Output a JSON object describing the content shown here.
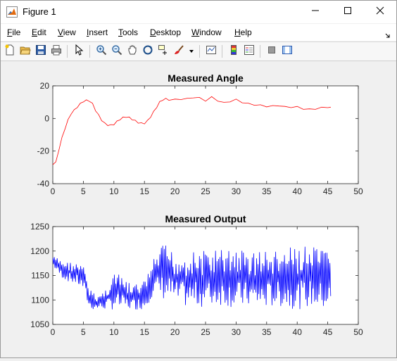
{
  "window": {
    "title": "Figure 1",
    "minimize_icon": "minimize-icon",
    "maximize_icon": "maximize-icon",
    "close_icon": "close-icon"
  },
  "menubar": {
    "items": [
      {
        "label": "File",
        "mnemonic": "F"
      },
      {
        "label": "Edit",
        "mnemonic": "E"
      },
      {
        "label": "View",
        "mnemonic": "V"
      },
      {
        "label": "Insert",
        "mnemonic": "I"
      },
      {
        "label": "Tools",
        "mnemonic": "T"
      },
      {
        "label": "Desktop",
        "mnemonic": "D"
      },
      {
        "label": "Window",
        "mnemonic": "W"
      },
      {
        "label": "Help",
        "mnemonic": "H"
      }
    ]
  },
  "toolbar": {
    "icons": [
      "new-figure-icon",
      "open-file-icon",
      "save-icon",
      "print-icon",
      "pointer-icon",
      "zoom-in-icon",
      "zoom-out-icon",
      "pan-icon",
      "rotate-3d-icon",
      "data-cursor-icon",
      "brush-icon",
      "link-plot-icon",
      "colorbar-icon",
      "legend-icon",
      "hide-plot-tools-icon",
      "show-plot-tools-icon"
    ]
  },
  "chart_data": [
    {
      "type": "line",
      "title": "Measured Angle",
      "xlabel": "",
      "ylabel": "",
      "xlim": [
        0,
        50
      ],
      "ylim": [
        -40,
        20
      ],
      "xticks": [
        "0",
        "5",
        "10",
        "15",
        "20",
        "25",
        "30",
        "35",
        "40",
        "45",
        "50"
      ],
      "yticks": [
        "-40",
        "-20",
        "0",
        "20"
      ],
      "grid": false,
      "series": [
        {
          "color": "#ff0000",
          "x": [
            0,
            0.5,
            1,
            1.5,
            2,
            2.5,
            3,
            3.5,
            4,
            4.5,
            5,
            5.5,
            6,
            6.5,
            7,
            7.5,
            8,
            8.5,
            9,
            9.5,
            10,
            10.5,
            11,
            11.5,
            12,
            12.5,
            13,
            13.5,
            14,
            14.5,
            15,
            15.5,
            16,
            16.5,
            17,
            17.5,
            18,
            18.5,
            19,
            20,
            21,
            22,
            23,
            24,
            25,
            26,
            27,
            28,
            29,
            30,
            31,
            32,
            33,
            34,
            35,
            36,
            37,
            38,
            39,
            40,
            41,
            42,
            43,
            44,
            45,
            45.5
          ],
          "y": [
            -28,
            -27,
            -19,
            -12,
            -6,
            -1,
            3,
            5,
            7,
            9,
            10.5,
            11,
            10.8,
            9,
            5,
            2,
            -1,
            -3,
            -4,
            -4.2,
            -3.5,
            -2,
            -0.5,
            0.5,
            1,
            0.5,
            -0.5,
            -1.5,
            -2.5,
            -3,
            -3,
            -1.5,
            1,
            4,
            7,
            10,
            11.5,
            12,
            11.5,
            11.5,
            12,
            12,
            13,
            12.5,
            11,
            13,
            11,
            9.5,
            10.5,
            11.5,
            10,
            9,
            8.5,
            8,
            7.5,
            7.5,
            8,
            7,
            7,
            7,
            6,
            5.5,
            6,
            6.5,
            7,
            6.5
          ]
        }
      ]
    },
    {
      "type": "line",
      "title": "Measured Output",
      "xlabel": "",
      "ylabel": "",
      "xlim": [
        0,
        50
      ],
      "ylim": [
        1050,
        1250
      ],
      "xticks": [
        "0",
        "5",
        "10",
        "15",
        "20",
        "25",
        "30",
        "35",
        "40",
        "45",
        "50"
      ],
      "yticks": [
        "1050",
        "1100",
        "1150",
        "1200",
        "1250"
      ],
      "grid": false,
      "series": [
        {
          "color": "#0000ff",
          "envelope_x": [
            0,
            1,
            2,
            3,
            4,
            5,
            5.5,
            6,
            7,
            8,
            9,
            10,
            11,
            12,
            13,
            14,
            15,
            16,
            17,
            18,
            19,
            20,
            22,
            24,
            26,
            28,
            30,
            32,
            34,
            36,
            38,
            40,
            42,
            44,
            45.5
          ],
          "envelope_high": [
            1190,
            1185,
            1180,
            1178,
            1176,
            1170,
            1150,
            1125,
            1110,
            1115,
            1130,
            1160,
            1150,
            1140,
            1130,
            1135,
            1140,
            1170,
            1195,
            1215,
            1210,
            1195,
            1200,
            1200,
            1205,
            1205,
            1210,
            1200,
            1205,
            1200,
            1205,
            1210,
            1210,
            1205,
            1200
          ],
          "envelope_low": [
            1170,
            1150,
            1140,
            1135,
            1130,
            1120,
            1100,
            1080,
            1080,
            1080,
            1080,
            1080,
            1080,
            1080,
            1080,
            1080,
            1080,
            1100,
            1110,
            1100,
            1100,
            1090,
            1085,
            1085,
            1085,
            1090,
            1080,
            1085,
            1080,
            1085,
            1085,
            1080,
            1085,
            1080,
            1080
          ]
        }
      ]
    }
  ]
}
